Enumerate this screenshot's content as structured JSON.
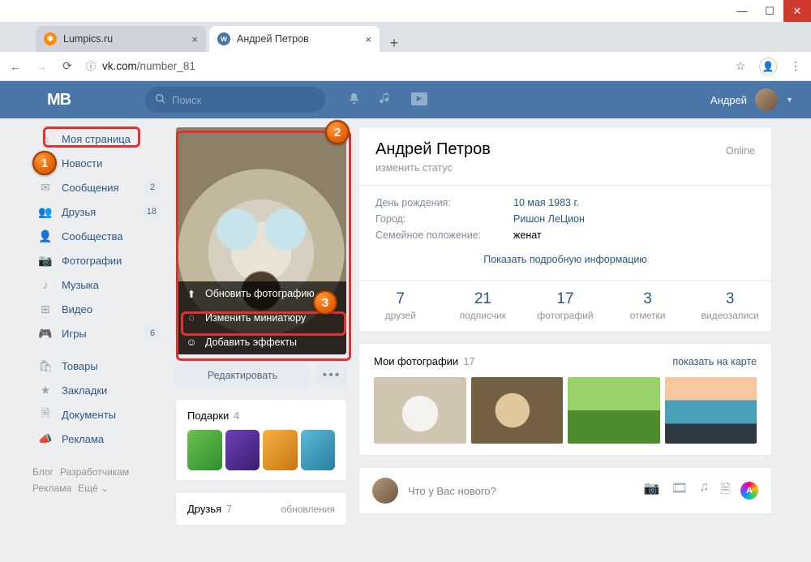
{
  "browser": {
    "tabs": [
      {
        "title": "Lumpics.ru",
        "fav": "L"
      },
      {
        "title": "Андрей Петров",
        "fav": "VK"
      }
    ],
    "url_host": "vk.com",
    "url_path": "/number_81"
  },
  "vk": {
    "search_placeholder": "Поиск",
    "user_name": "Андрей"
  },
  "sidebar": {
    "items": [
      {
        "label": "Моя страница",
        "badge": ""
      },
      {
        "label": "Новости",
        "badge": ""
      },
      {
        "label": "Сообщения",
        "badge": "2"
      },
      {
        "label": "Друзья",
        "badge": "18"
      },
      {
        "label": "Сообщества",
        "badge": ""
      },
      {
        "label": "Фотографии",
        "badge": ""
      },
      {
        "label": "Музыка",
        "badge": ""
      },
      {
        "label": "Видео",
        "badge": ""
      },
      {
        "label": "Игры",
        "badge": "6"
      },
      {
        "label": "Товары",
        "badge": ""
      },
      {
        "label": "Закладки",
        "badge": ""
      },
      {
        "label": "Документы",
        "badge": ""
      },
      {
        "label": "Реклама",
        "badge": ""
      }
    ],
    "footer": [
      "Блог",
      "Разработчикам",
      "Реклама",
      "Ещё ⌄"
    ]
  },
  "avatar_menu": {
    "update": "Обновить фотографию",
    "thumb": "Изменить миниатюру",
    "effects": "Добавить эффекты"
  },
  "edit_btn": "Редактировать",
  "gifts": {
    "title": "Подарки",
    "count": "4"
  },
  "friends_block": {
    "title": "Друзья",
    "count": "7",
    "sub": "обновления"
  },
  "profile": {
    "name": "Андрей Петров",
    "online": "Online",
    "status": "изменить статус",
    "rows": [
      {
        "k": "День рождения:",
        "v": "10 мая 1983 г.",
        "link": true
      },
      {
        "k": "Город:",
        "v": "Ришон ЛеЦион",
        "link": true
      },
      {
        "k": "Семейное положение:",
        "v": "женат",
        "link": false
      }
    ],
    "show_more": "Показать подробную информацию",
    "counters": [
      {
        "n": "7",
        "l": "друзей"
      },
      {
        "n": "21",
        "l": "подписчик"
      },
      {
        "n": "17",
        "l": "фотографий"
      },
      {
        "n": "3",
        "l": "отметки"
      },
      {
        "n": "3",
        "l": "видеозаписи"
      }
    ]
  },
  "photos": {
    "title": "Мои фотографии",
    "count": "17",
    "map": "показать на карте"
  },
  "post": {
    "placeholder": "Что у Вас нового?"
  },
  "annotations": {
    "b1": "1",
    "b2": "2",
    "b3": "3"
  }
}
